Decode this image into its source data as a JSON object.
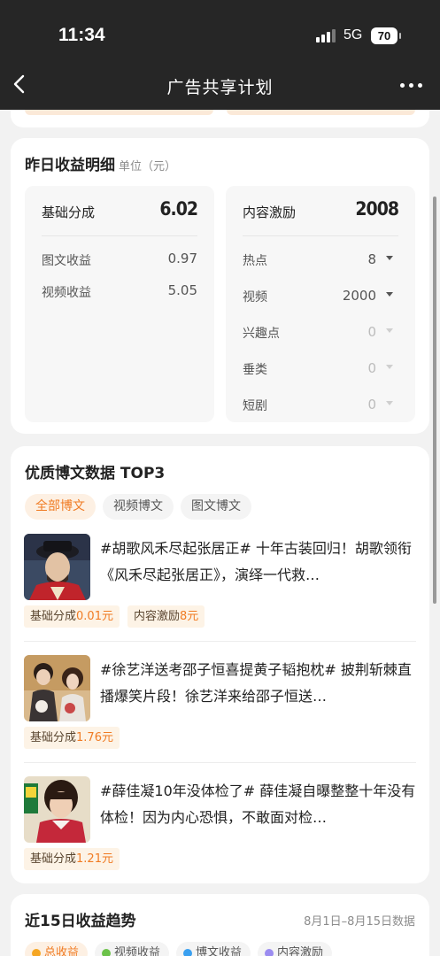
{
  "status_bar": {
    "time": "11:34",
    "network": "5G",
    "battery": "70"
  },
  "nav": {
    "title": "广告共享计划"
  },
  "income": {
    "title": "昨日收益明细",
    "unit": "单位（元）",
    "base": {
      "label": "基础分成",
      "value": "6.02",
      "rows": [
        {
          "label": "图文收益",
          "value": "0.97"
        },
        {
          "label": "视频收益",
          "value": "5.05"
        }
      ]
    },
    "content": {
      "label": "内容激励",
      "value": "2008",
      "rows": [
        {
          "label": "热点",
          "value": "8"
        },
        {
          "label": "视频",
          "value": "2000"
        },
        {
          "label": "兴趣点",
          "value": "0"
        },
        {
          "label": "垂类",
          "value": "0"
        },
        {
          "label": "短剧",
          "value": "0"
        }
      ]
    }
  },
  "top3": {
    "title": "优质博文数据 TOP3",
    "tabs": [
      "全部博文",
      "视频博文",
      "图文博文"
    ],
    "active_tab": "全部博文",
    "posts": [
      {
        "text": "#胡歌风禾尽起张居正# 十年古装回归！胡歌领衔《风禾尽起张居正》，演绎一代救…",
        "tags": [
          {
            "prefix": "基础分成",
            "value": "0.01元"
          },
          {
            "prefix": "内容激励",
            "value": "8元"
          }
        ]
      },
      {
        "text": "#徐艺洋送考邵子恒喜提黄子韬抱枕# 披荆斩棘直播爆笑片段！徐艺洋来给邵子恒送…",
        "tags": [
          {
            "prefix": "基础分成",
            "value": "1.76元"
          }
        ]
      },
      {
        "text": "#薛佳凝10年没体检了# 薛佳凝自曝整整十年没有体检！因为内心恐惧，不敢面对检…",
        "tags": [
          {
            "prefix": "基础分成",
            "value": "1.21元"
          }
        ]
      }
    ]
  },
  "trend": {
    "title": "近15日收益趋势",
    "range": "8月1日–8月15日数据",
    "legend": [
      {
        "label": "总收益",
        "color": "#f5a623"
      },
      {
        "label": "视频收益",
        "color": "#6cc24a"
      },
      {
        "label": "博文收益",
        "color": "#3aa0f0"
      },
      {
        "label": "内容激励",
        "color": "#9b8cf0"
      }
    ]
  }
}
